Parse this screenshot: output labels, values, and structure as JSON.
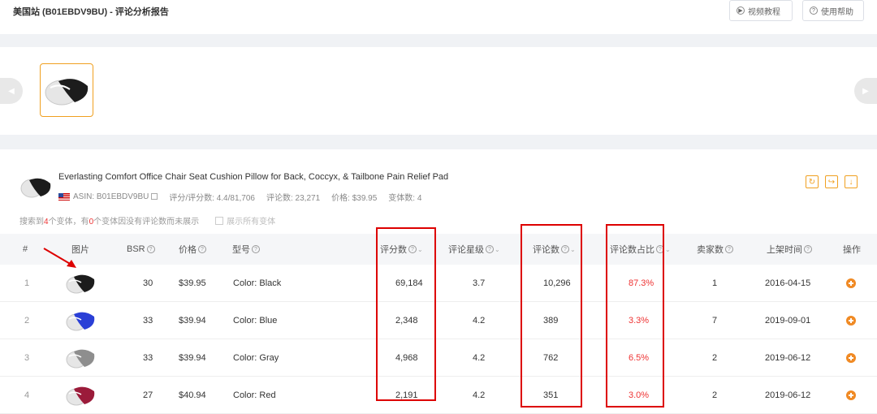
{
  "header": {
    "title": "美国站 (B01EBDV9BU) - 评论分析报告",
    "video_btn": "视频教程",
    "help_btn": "使用帮助"
  },
  "product": {
    "title": "Everlasting Comfort Office Chair Seat Cushion Pillow for Back, Coccyx, & Tailbone Pain Relief Pad",
    "asin": "ASIN: B01EBDV9BU",
    "rating": "评分/评分数: 4.4/81,706",
    "reviews": "评论数: 23,271",
    "price": "价格: $39.95",
    "variants": "变体数: 4"
  },
  "note": {
    "pre": "搜索到",
    "count_found": "4",
    "mid": "个变体，有",
    "count_none": "0",
    "post": "个变体因没有评论数而未展示",
    "show_all": "展示所有变体"
  },
  "table": {
    "headers": {
      "idx": "#",
      "img": "图片",
      "bsr": "BSR",
      "price": "价格",
      "model": "型号",
      "rating_count": "评分数",
      "stars": "评论星级",
      "reviews": "评论数",
      "review_pct": "评论数占比",
      "sellers": "卖家数",
      "launch": "上架时间",
      "action": "操作"
    },
    "rows": [
      {
        "idx": "1",
        "bsr": "30",
        "price": "$39.95",
        "model": "Color: Black",
        "rating_count": "69,184",
        "stars": "3.7",
        "reviews": "10,296",
        "pct": "87.3%",
        "sellers": "1",
        "date": "2016-04-15",
        "color": "#1c1c1c"
      },
      {
        "idx": "2",
        "bsr": "33",
        "price": "$39.94",
        "model": "Color: Blue",
        "rating_count": "2,348",
        "stars": "4.2",
        "reviews": "389",
        "pct": "3.3%",
        "sellers": "7",
        "date": "2019-09-01",
        "color": "#2a3fd6"
      },
      {
        "idx": "3",
        "bsr": "33",
        "price": "$39.94",
        "model": "Color: Gray",
        "rating_count": "4,968",
        "stars": "4.2",
        "reviews": "762",
        "pct": "6.5%",
        "sellers": "2",
        "date": "2019-06-12",
        "color": "#8e8e8e"
      },
      {
        "idx": "4",
        "bsr": "27",
        "price": "$40.94",
        "model": "Color: Red",
        "rating_count": "2,191",
        "stars": "4.2",
        "reviews": "351",
        "pct": "3.0%",
        "sellers": "2",
        "date": "2019-06-12",
        "color": "#9b1b3a"
      }
    ]
  },
  "colors": {
    "accent": "#f0a020",
    "highlight": "#dd0000",
    "pct_text": "#ee3333"
  },
  "icons": {
    "video": "play-circle-icon",
    "help": "help-circle-icon",
    "refresh": "refresh-icon",
    "share": "share-icon",
    "download": "download-icon",
    "operate": "plus-circle-icon"
  }
}
